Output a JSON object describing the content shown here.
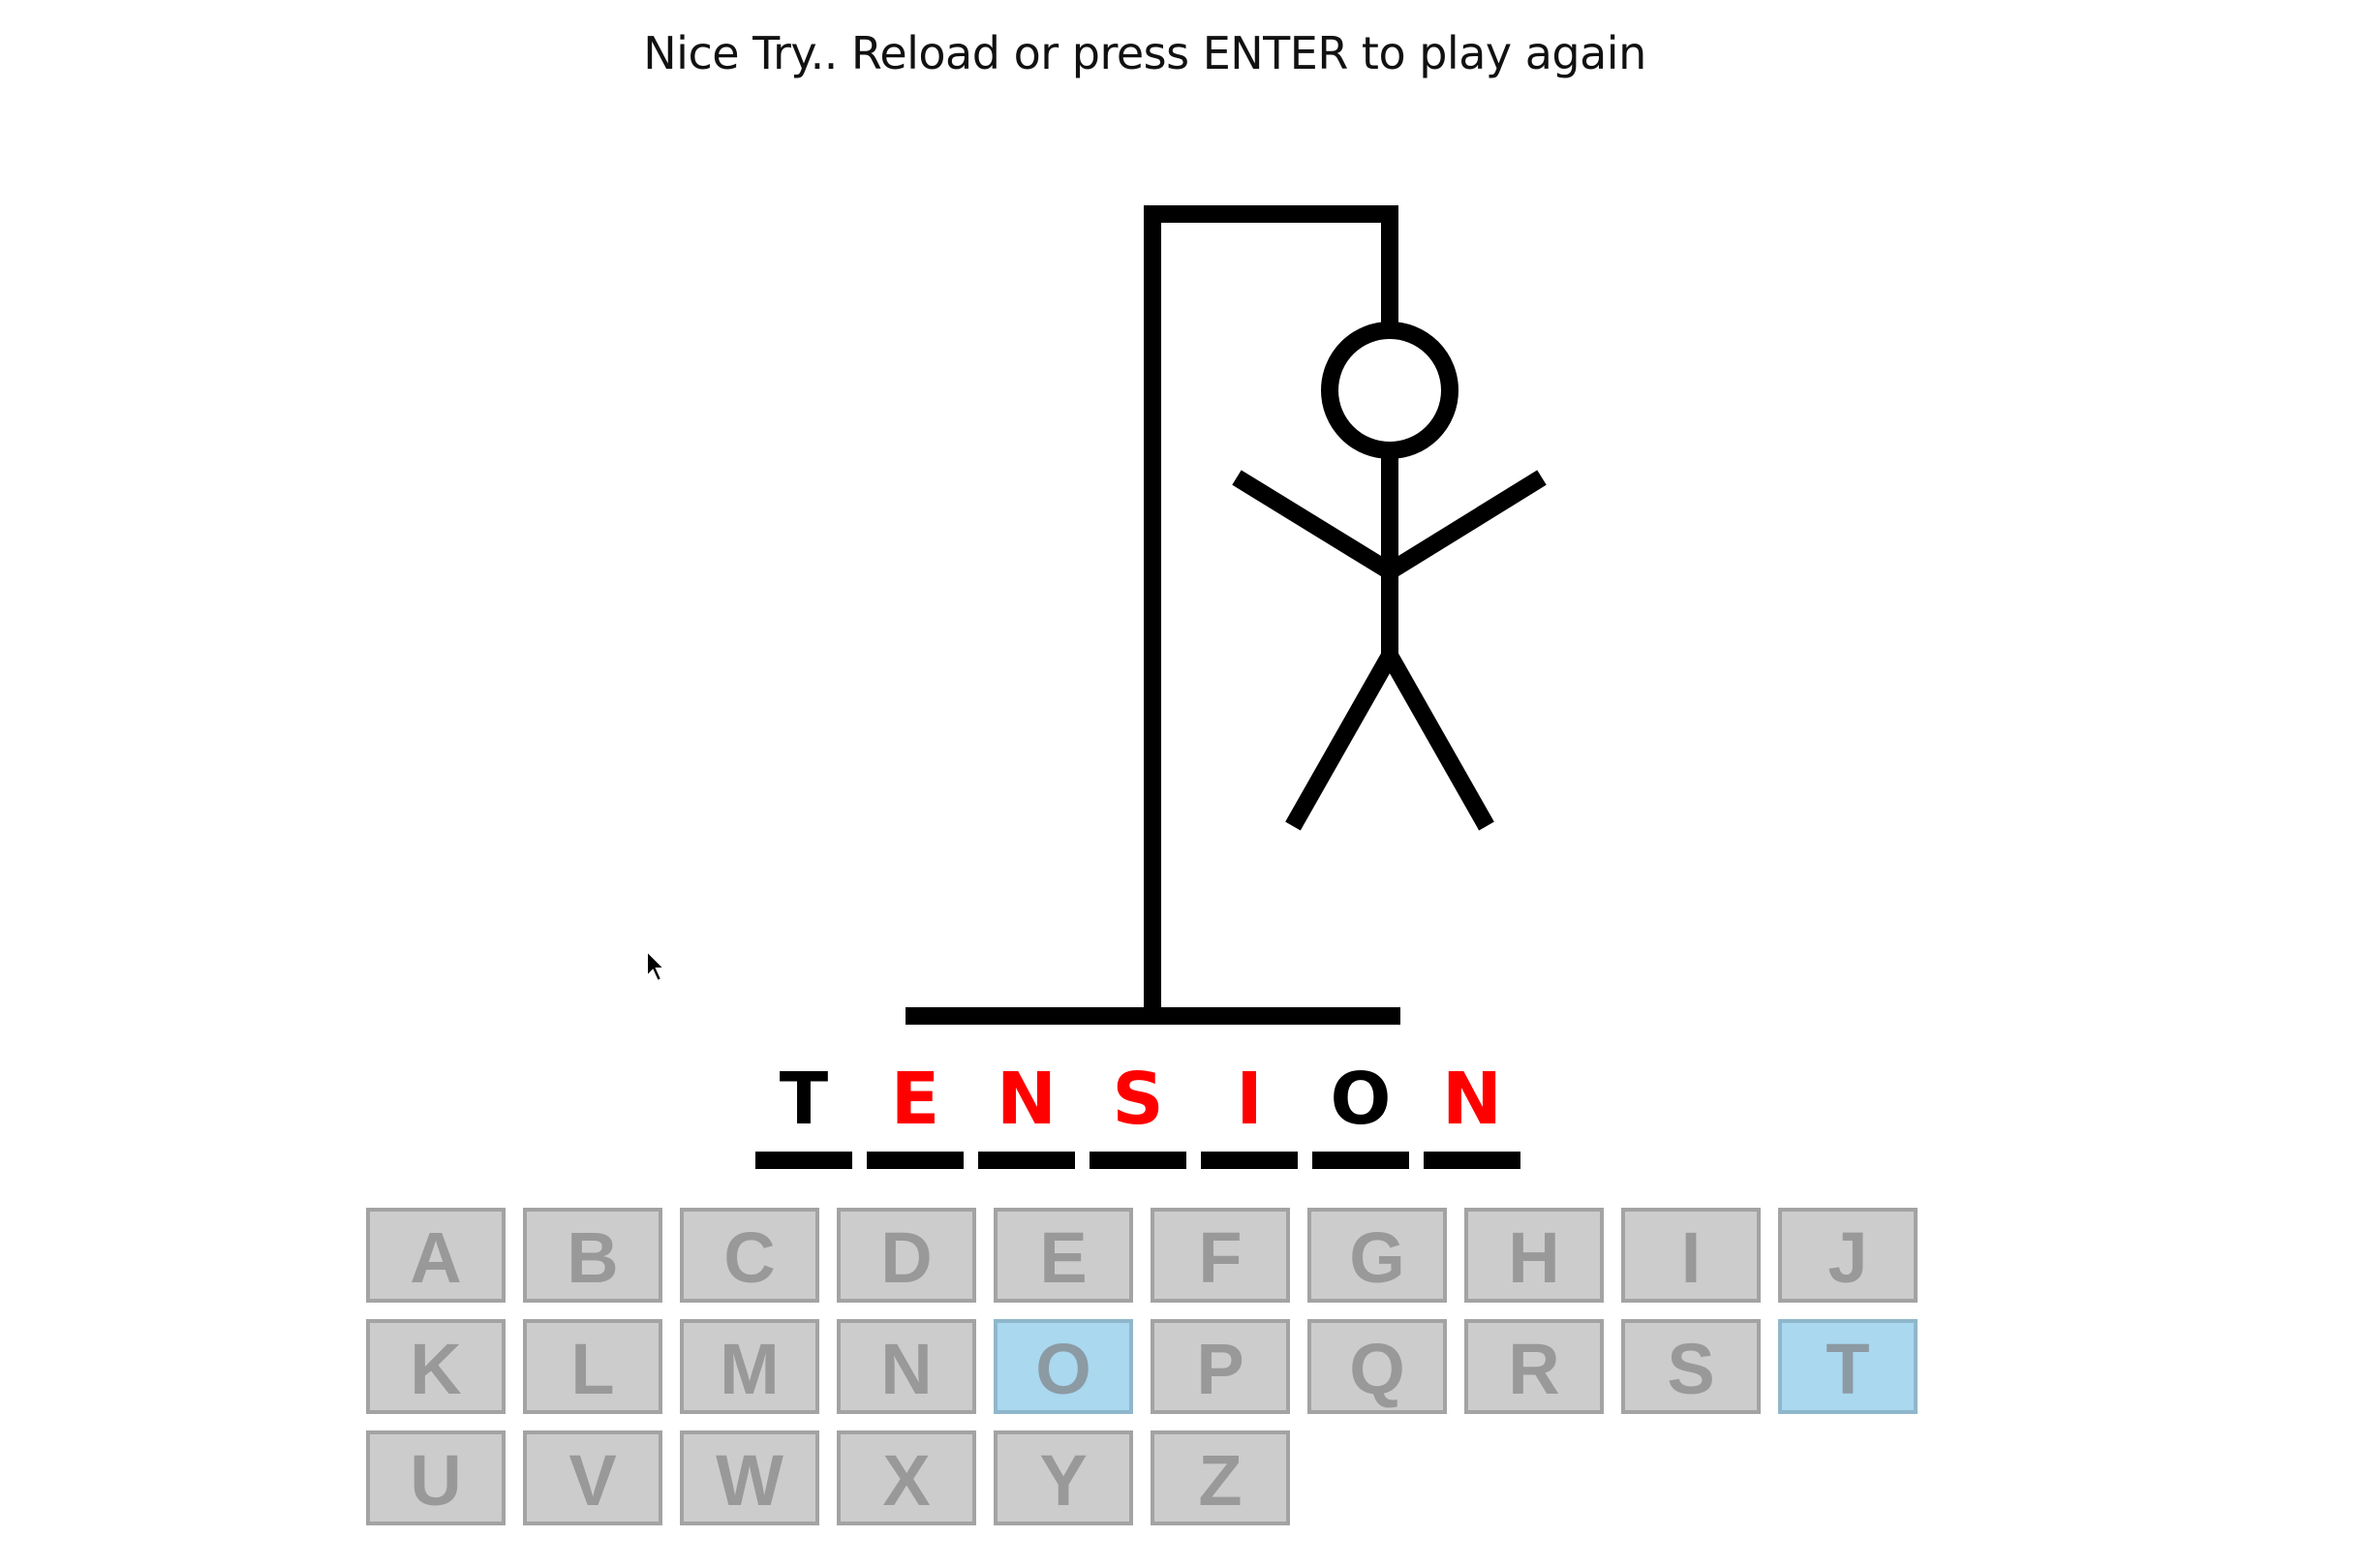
{
  "message": "Nice Try.. Reload or press ENTER to play again",
  "word": [
    {
      "char": "T",
      "state": "guessed"
    },
    {
      "char": "E",
      "state": "missed"
    },
    {
      "char": "N",
      "state": "missed"
    },
    {
      "char": "S",
      "state": "missed"
    },
    {
      "char": "I",
      "state": "missed"
    },
    {
      "char": "O",
      "state": "guessed"
    },
    {
      "char": "N",
      "state": "missed"
    }
  ],
  "colors": {
    "guessed": "#000000",
    "missed": "#ff0000",
    "key_default": "#cccccc",
    "key_used": "#a9d8ef"
  },
  "keyboard": {
    "rows": [
      [
        "A",
        "B",
        "C",
        "D",
        "E",
        "F",
        "G",
        "H",
        "I",
        "J"
      ],
      [
        "K",
        "L",
        "M",
        "N",
        "O",
        "P",
        "Q",
        "R",
        "S",
        "T"
      ],
      [
        "U",
        "V",
        "W",
        "X",
        "Y",
        "Z"
      ]
    ],
    "used": [
      "O",
      "T"
    ]
  },
  "hangman_parts_shown": [
    "base",
    "pole",
    "beam",
    "rope",
    "head",
    "body",
    "left-arm",
    "right-arm",
    "left-leg",
    "right-leg"
  ]
}
